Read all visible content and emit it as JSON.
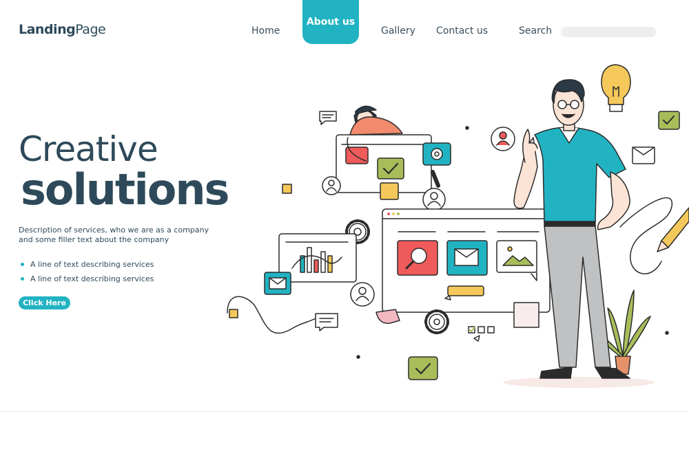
{
  "brand": {
    "logo_bold": "Landing",
    "logo_regular": "Page"
  },
  "nav": {
    "home": "Home",
    "about": "About us",
    "gallery": "Gallery",
    "contact": "Contact us",
    "search_label": "Search",
    "search_placeholder": ""
  },
  "hero": {
    "title_line1": "Creative",
    "title_line2": "solutions",
    "description": "Description of services, who we are as a company and some filler text about the company",
    "bullets": [
      "A line of text describing services",
      "A line of text describing services"
    ],
    "cta_label": "Click Here"
  },
  "colors": {
    "accent": "#22b3c2",
    "text_dark": "#2e4a5a",
    "coral": "#ef5a5a",
    "olive": "#a8bd5a",
    "yellow": "#f4c85a"
  },
  "illustration": {
    "icons": [
      "chat-bubble-icon",
      "checkmark-icon",
      "gear-icon",
      "user-icon",
      "magnifier-icon",
      "mail-icon",
      "image-icon",
      "bar-chart-icon",
      "lightbulb-icon",
      "pencil-icon",
      "plant-icon"
    ]
  }
}
